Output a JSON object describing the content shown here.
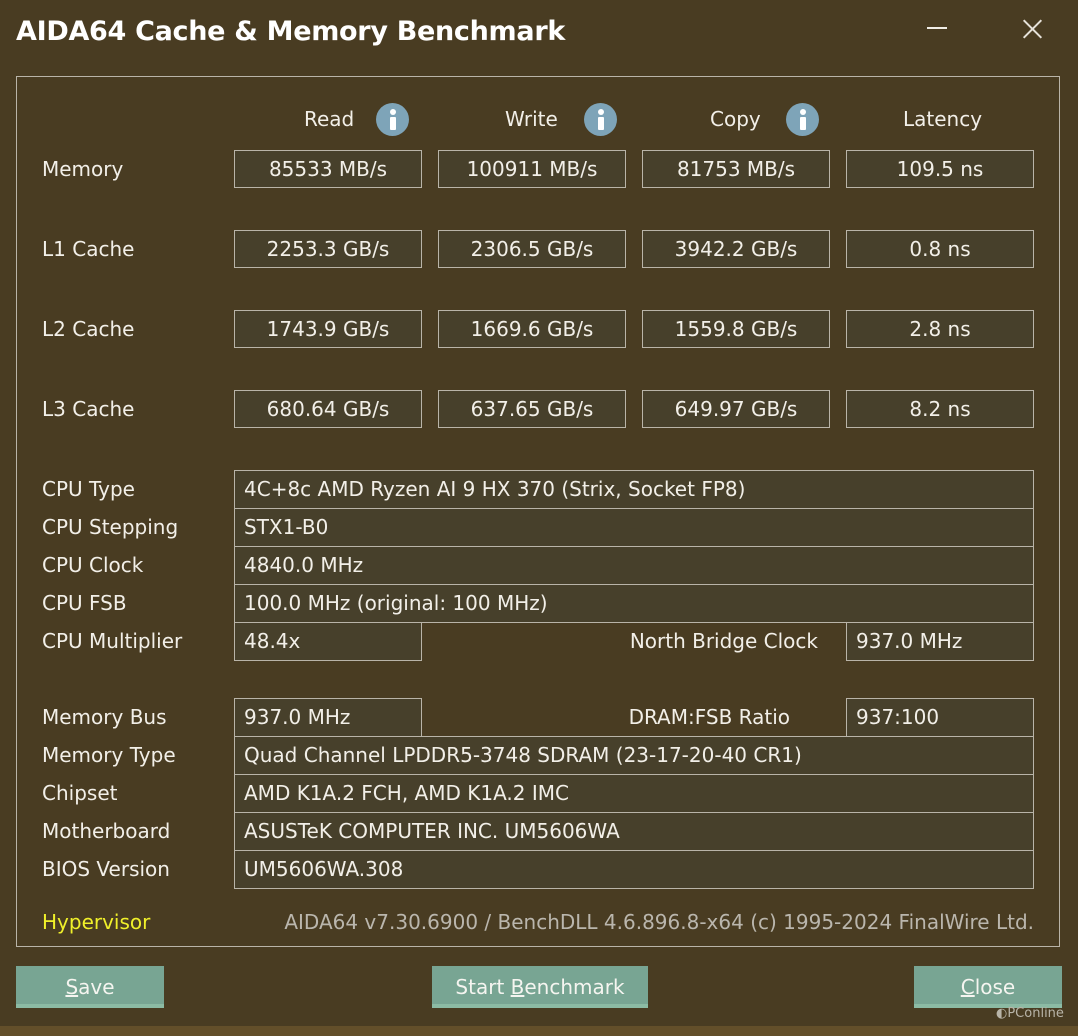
{
  "window": {
    "title": "AIDA64 Cache & Memory Benchmark",
    "minimize_icon": "minimize-icon",
    "close_icon": "close-icon"
  },
  "benchmark": {
    "columns": [
      {
        "label": "Read",
        "has_info": true
      },
      {
        "label": "Write",
        "has_info": true
      },
      {
        "label": "Copy",
        "has_info": true
      },
      {
        "label": "Latency",
        "has_info": false
      }
    ],
    "rows": [
      {
        "label": "Memory",
        "values": [
          "85533 MB/s",
          "100911 MB/s",
          "81753 MB/s",
          "109.5 ns"
        ]
      },
      {
        "label": "L1 Cache",
        "values": [
          "2253.3 GB/s",
          "2306.5 GB/s",
          "3942.2 GB/s",
          "0.8 ns"
        ]
      },
      {
        "label": "L2 Cache",
        "values": [
          "1743.9 GB/s",
          "1669.6 GB/s",
          "1559.8 GB/s",
          "2.8 ns"
        ]
      },
      {
        "label": "L3 Cache",
        "values": [
          "680.64 GB/s",
          "637.65 GB/s",
          "649.97 GB/s",
          "8.2 ns"
        ]
      }
    ]
  },
  "info": {
    "cpu_type": {
      "label": "CPU Type",
      "value": "4C+8c AMD Ryzen AI 9 HX 370  (Strix, Socket FP8)"
    },
    "cpu_stepping": {
      "label": "CPU Stepping",
      "value": "STX1-B0"
    },
    "cpu_clock": {
      "label": "CPU Clock",
      "value": "4840.0 MHz"
    },
    "cpu_fsb": {
      "label": "CPU FSB",
      "value": "100.0 MHz  (original: 100 MHz)"
    },
    "cpu_multiplier": {
      "label": "CPU Multiplier",
      "value": "48.4x"
    },
    "north_bridge_clock": {
      "label": "North Bridge Clock",
      "value": "937.0 MHz"
    },
    "memory_bus": {
      "label": "Memory Bus",
      "value": "937.0 MHz"
    },
    "dram_fsb_ratio": {
      "label": "DRAM:FSB Ratio",
      "value": "937:100"
    },
    "memory_type": {
      "label": "Memory Type",
      "value": "Quad Channel LPDDR5-3748 SDRAM  (23-17-20-40 CR1)"
    },
    "chipset": {
      "label": "Chipset",
      "value": "AMD K1A.2 FCH, AMD K1A.2 IMC"
    },
    "motherboard": {
      "label": "Motherboard",
      "value": "ASUSTeK COMPUTER INC. UM5606WA"
    },
    "bios_version": {
      "label": "BIOS Version",
      "value": "UM5606WA.308"
    }
  },
  "footer": {
    "hypervisor": "Hypervisor",
    "version": "AIDA64 v7.30.6900 / BenchDLL 4.6.896.8-x64  (c) 1995-2024 FinalWire Ltd."
  },
  "buttons": {
    "save": {
      "accel": "S",
      "rest": "ave"
    },
    "start": {
      "pre": "Start ",
      "accel": "B",
      "rest": "enchmark"
    },
    "close": {
      "accel": "C",
      "rest": "lose"
    }
  },
  "watermark": "PConline",
  "colors": {
    "background": "#493c22",
    "value_box": "#47402b",
    "button": "#78a593",
    "hypervisor": "#f0f02a",
    "info_icon": "#7ea4b8"
  }
}
